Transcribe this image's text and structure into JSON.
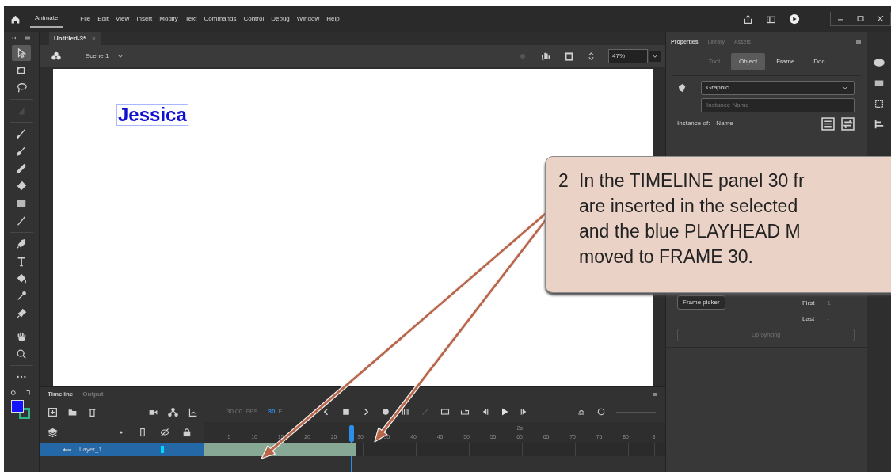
{
  "menu_bar": {
    "app_tab": "Animate",
    "menus": [
      "File",
      "Edit",
      "View",
      "Insert",
      "Modify",
      "Text",
      "Commands",
      "Control",
      "Debug",
      "Window",
      "Help"
    ]
  },
  "document_tab": {
    "title": "Untitled-3*",
    "close": "×"
  },
  "scene_bar": {
    "scene": "Scene 1",
    "zoom": "47%"
  },
  "tool_groups": [
    {
      "tools": [
        {
          "kind": "selection",
          "selected": true
        },
        {
          "kind": "free-transform",
          "selected": false
        },
        {
          "kind": "lasso",
          "selected": false
        }
      ]
    },
    {
      "tools": [
        {
          "kind": "blank",
          "selected": false
        }
      ]
    },
    {
      "tools": [
        {
          "kind": "brush",
          "selected": false
        },
        {
          "kind": "paint-brush",
          "selected": false
        },
        {
          "kind": "pencil",
          "selected": false
        },
        {
          "kind": "eraser",
          "selected": false
        },
        {
          "kind": "rectangle",
          "selected": false
        },
        {
          "kind": "line",
          "selected": false
        }
      ]
    },
    {
      "tools": [
        {
          "kind": "pen",
          "selected": false
        },
        {
          "kind": "text",
          "selected": false
        },
        {
          "kind": "bucket",
          "selected": false
        },
        {
          "kind": "eyedropper",
          "selected": false
        },
        {
          "kind": "pin",
          "selected": false
        }
      ]
    },
    {
      "tools": [
        {
          "kind": "hand",
          "selected": false
        },
        {
          "kind": "zoom",
          "selected": false
        }
      ]
    },
    {
      "tools": [
        {
          "kind": "more",
          "selected": false
        }
      ]
    }
  ],
  "swatches": [
    {
      "color": "#1414ff"
    },
    {
      "color": "#2fb58a"
    }
  ],
  "stage": {
    "text": "Jessica"
  },
  "properties": {
    "tabs": [
      {
        "label": "Properties",
        "selected": true
      },
      {
        "label": "Library",
        "selected": false
      },
      {
        "label": "Assets",
        "selected": false
      }
    ],
    "sub_tabs": [
      {
        "label": "Tool",
        "selected": false
      },
      {
        "label": "Object",
        "selected": true
      },
      {
        "label": "Frame",
        "selected": false
      },
      {
        "label": "Doc",
        "selected": false
      }
    ],
    "symbol_type": "Graphic",
    "instance_name_placeholder": "Instance Name",
    "instance_of_label": "Instance of:",
    "instance_of_value": "Name",
    "frame_picker": "Frame picker",
    "first_label": "First",
    "first_value": "1",
    "last_label": "Last",
    "last_value": "-",
    "lip_syncing": "Lip Syncing"
  },
  "timeline": {
    "tabs": [
      {
        "label": "Timeline",
        "selected": true
      },
      {
        "label": "Output",
        "selected": false
      }
    ],
    "fps": "30.00",
    "fps_unit": "FPS",
    "frame": "30",
    "frame_unit": "F",
    "ruler": [
      {
        "label": "5",
        "playhead": false
      },
      {
        "label": "10",
        "playhead": false
      },
      {
        "label": "15",
        "playhead": false
      },
      {
        "label": "20",
        "playhead": false
      },
      {
        "label": "25",
        "playhead": false
      },
      {
        "label": "30",
        "playhead": true
      },
      {
        "label": "35",
        "playhead": false
      },
      {
        "label": "40",
        "playhead": false
      },
      {
        "label": "45",
        "playhead": false
      },
      {
        "label": "50",
        "playhead": false
      },
      {
        "label": "55",
        "playhead": false
      },
      {
        "label": "60",
        "playhead": false,
        "seconds": "2s"
      },
      {
        "label": "65",
        "playhead": false
      },
      {
        "label": "70",
        "playhead": false
      },
      {
        "label": "75",
        "playhead": false
      },
      {
        "label": "80",
        "playhead": false
      },
      {
        "label": "8",
        "playhead": false
      }
    ],
    "layers": [
      {
        "name": "Layer_1",
        "selected": true,
        "color": "#00d8ff"
      }
    ]
  },
  "callout": {
    "number": "2",
    "lines": [
      "In the TIMELINE panel 30 fr",
      "are inserted in the selected",
      "and the blue PLAYHEAD M",
      "moved to FRAME 30."
    ]
  }
}
